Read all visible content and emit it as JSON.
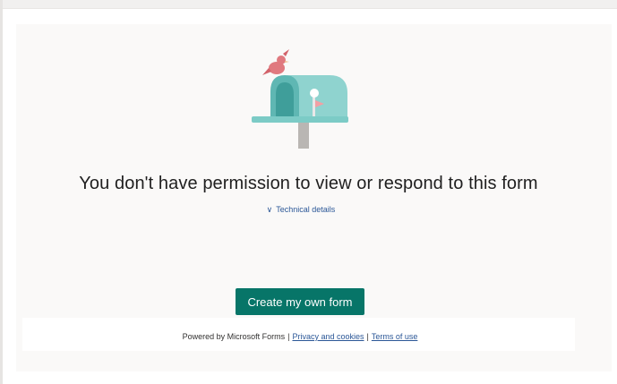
{
  "message": {
    "heading": "You don't have permission to view or respond to this form",
    "technical_details_label": "Technical details"
  },
  "actions": {
    "create_form_label": "Create my own form"
  },
  "footer": {
    "powered_by": "Powered by Microsoft Forms",
    "separator": "|",
    "privacy_link": "Privacy and cookies",
    "terms_link": "Terms of use"
  },
  "icons": {
    "illustration": "mailbox-with-bird-illustration",
    "expand": "chevron-down-icon"
  },
  "colors": {
    "primary_button": "#077568",
    "link": "#2b5797",
    "panel_background": "#faf9f8",
    "mailbox": "#8fd3cf"
  }
}
